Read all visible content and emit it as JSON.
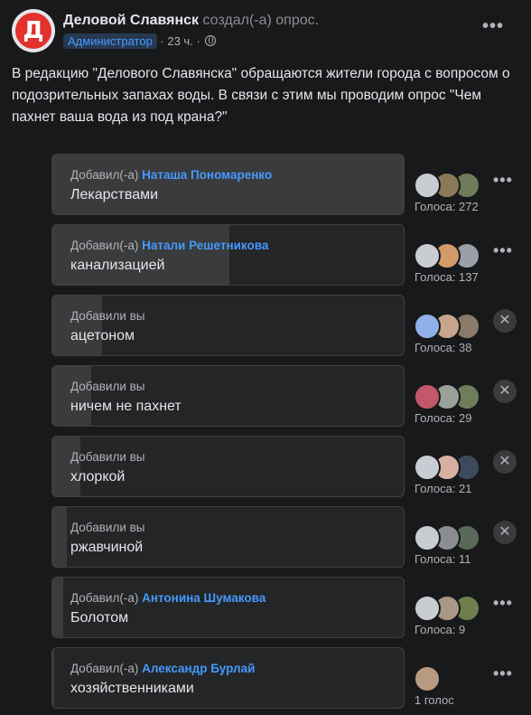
{
  "post": {
    "page_name": "Деловой Славянск",
    "action_text": "создал(-а) опрос.",
    "role": "Администратор",
    "time": "23 ч.",
    "avatar_letter": "Д",
    "text": "В редакцию \"Делового Славянска\" обращаются жители города с вопросом о подозрительных запахах воды. В связи с этим мы проводим опрос \"Чем пахнет ваша вода из под крана?\""
  },
  "poll": {
    "options": [
      {
        "added_prefix": "Добавил(-а)",
        "added_by": "Наташа Пономаренко",
        "answer": "Лекарствами",
        "votes": "Голоса: 272",
        "fill": 1.0,
        "control": "more",
        "voter_colors": [
          "#c9cdd3",
          "#8a7b58",
          "#6f7b5a"
        ]
      },
      {
        "added_prefix": "Добавил(-а)",
        "added_by": "Натали Решетникова",
        "answer": "канализацией",
        "votes": "Голоса: 137",
        "fill": 0.5,
        "control": "more",
        "voter_colors": [
          "#c9cdd3",
          "#d39a6a",
          "#9aa0a8"
        ]
      },
      {
        "added_prefix": "Добавили вы",
        "added_by": "",
        "answer": "ацетоном",
        "votes": "Голоса: 38",
        "fill": 0.14,
        "control": "remove",
        "voter_colors": [
          "#8fb0e8",
          "#c8a58a",
          "#8b7a6a"
        ]
      },
      {
        "added_prefix": "Добавили вы",
        "added_by": "",
        "answer": "ничем не пахнет",
        "votes": "Голоса: 29",
        "fill": 0.11,
        "control": "remove",
        "voter_colors": [
          "#c2586a",
          "#9aa09a",
          "#6e7d5a"
        ]
      },
      {
        "added_prefix": "Добавили вы",
        "added_by": "",
        "answer": "хлоркой",
        "votes": "Голоса: 21",
        "fill": 0.08,
        "control": "remove",
        "voter_colors": [
          "#c9cdd3",
          "#d8b0a2",
          "#3d4a5e"
        ]
      },
      {
        "added_prefix": "Добавили вы",
        "added_by": "",
        "answer": "ржавчиной",
        "votes": "Голоса: 11",
        "fill": 0.04,
        "control": "remove",
        "voter_colors": [
          "#c9cdd3",
          "#8b8d90",
          "#5a6a5a"
        ]
      },
      {
        "added_prefix": "Добавил(-а)",
        "added_by": "Антонина Шумакова",
        "answer": "Болотом",
        "votes": "Голоса: 9",
        "fill": 0.03,
        "control": "more",
        "voter_colors": [
          "#c9cdd3",
          "#a89888",
          "#6f7d4a"
        ]
      },
      {
        "added_prefix": "Добавил(-а)",
        "added_by": "Александр Бурлай",
        "answer": "хозяйственниками",
        "votes": "1 голос",
        "fill": 0.003,
        "control": "more",
        "voter_colors": [
          "#b89a80"
        ]
      }
    ]
  },
  "icons": {
    "more": "more-horizontal-icon",
    "remove": "close-icon",
    "privacy": "globe-icon"
  }
}
